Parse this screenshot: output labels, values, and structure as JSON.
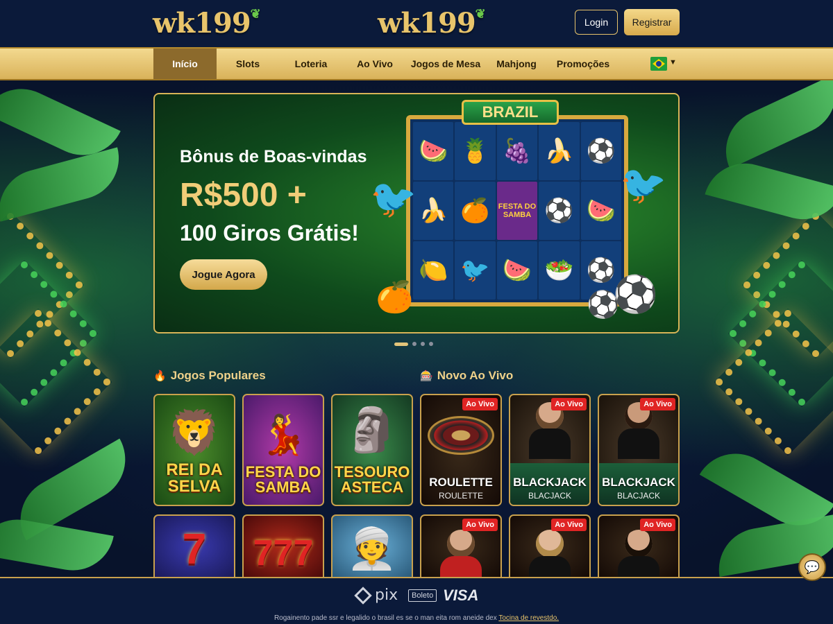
{
  "header": {
    "logo_left": "wk199",
    "logo_center": "wk199",
    "login_label": "Login",
    "register_label": "Registrar"
  },
  "nav": {
    "items": [
      {
        "label": "Início",
        "active": true
      },
      {
        "label": "Slots"
      },
      {
        "label": "Loteria"
      },
      {
        "label": "Ao Vivo"
      },
      {
        "label": "Jogos de Mesa"
      },
      {
        "label": "Mahjong"
      },
      {
        "label": "Promoções"
      }
    ],
    "language_icon": "brazil-flag-icon"
  },
  "banner": {
    "line1": "Bônus de Boas-vindas",
    "line2": "R$500 +",
    "line3": "100 Giros Grátis!",
    "cta_label": "Jogue Agora",
    "slot_title": "BRAZIL",
    "slot_symbol_text": "FESTA DO SAMBA",
    "carousel_active": 1,
    "carousel_total": 4
  },
  "popular": {
    "title": "Jogos Populares",
    "icon": "fire-icon",
    "games": [
      {
        "title": "REI DA SELVA"
      },
      {
        "title": "FESTA DO SAMBA"
      },
      {
        "title": "TESOURO ASTECA"
      },
      {
        "title": "7"
      },
      {
        "title": "777"
      },
      {
        "title": ""
      }
    ]
  },
  "live": {
    "title": "Novo Ao Vivo",
    "icon": "live-dealer-icon",
    "badge": "Ao Vivo",
    "games": [
      {
        "name": "ROULETTE",
        "sub": "ROULETTE"
      },
      {
        "name": "BLACKJACK",
        "sub": "BLACJACK"
      },
      {
        "name": "BLACKJACK",
        "sub": "BLACJACK"
      }
    ]
  },
  "footer": {
    "pix": "pix",
    "boleto": "Boleto",
    "visa": "VISA",
    "text": "Rogainento pade ssr e legalido o brasil es se o man eita rom aneide dex",
    "link": "Tocina de revestdo."
  },
  "chat_icon": "chat-bubble-icon"
}
